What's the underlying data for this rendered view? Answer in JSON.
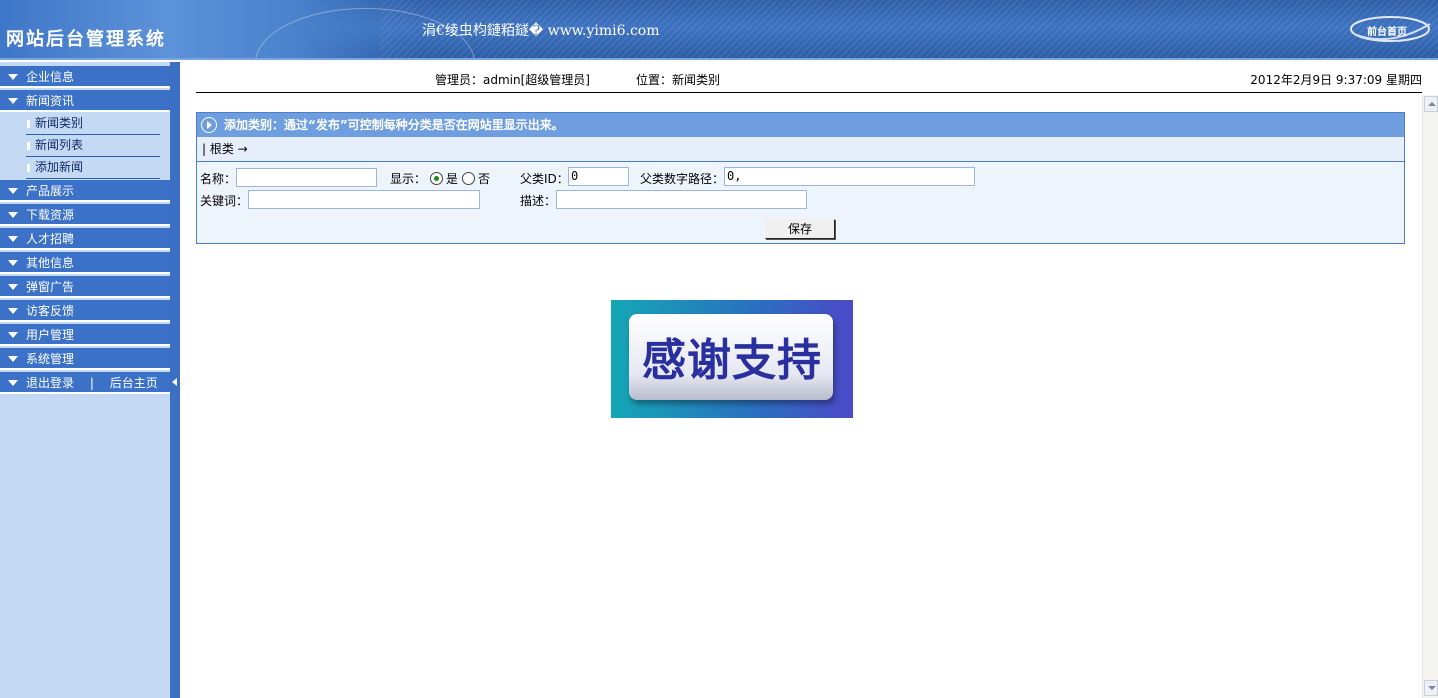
{
  "header": {
    "title": "网站后台管理系统",
    "url_text": "涓€绫虫枃鏈粨鐩� www.yimi6.com",
    "home_label": "前台首页"
  },
  "sidebar": {
    "groups": [
      {
        "label": "企业信息"
      },
      {
        "label": "新闻资讯",
        "items": [
          {
            "label": "新闻类别"
          },
          {
            "label": "新闻列表"
          },
          {
            "label": "添加新闻"
          }
        ]
      },
      {
        "label": "产品展示"
      },
      {
        "label": "下载资源"
      },
      {
        "label": "人才招聘"
      },
      {
        "label": "其他信息"
      },
      {
        "label": "弹窗广告"
      },
      {
        "label": "访客反馈"
      },
      {
        "label": "用户管理"
      },
      {
        "label": "系统管理"
      }
    ],
    "logout_label": "退出登录",
    "separator": "|",
    "admin_home_label": "后台主页"
  },
  "topbar": {
    "admin_info": "管理员：admin[超级管理员]",
    "location": "位置：新闻类别",
    "datetime": "2012年2月9日 9:37:09 星期四"
  },
  "panel": {
    "title": "添加类别：通过“发布”可控制每种分类是否在网站里显示出来。",
    "breadcrumb": "| 根类 →",
    "form": {
      "name_label": "名称：",
      "name_value": "",
      "display_label": "显示：",
      "display_yes": "是",
      "display_no": "否",
      "display_selected": "是",
      "parent_id_label": "父类ID：",
      "parent_id_value": "0",
      "parent_path_label": "父类数字路径：",
      "parent_path_value": "0,",
      "keywords_label": "关键词：",
      "keywords_value": "",
      "description_label": "描述：",
      "description_value": "",
      "save_label": "保存"
    }
  },
  "banner": {
    "text": "感谢支持"
  }
}
